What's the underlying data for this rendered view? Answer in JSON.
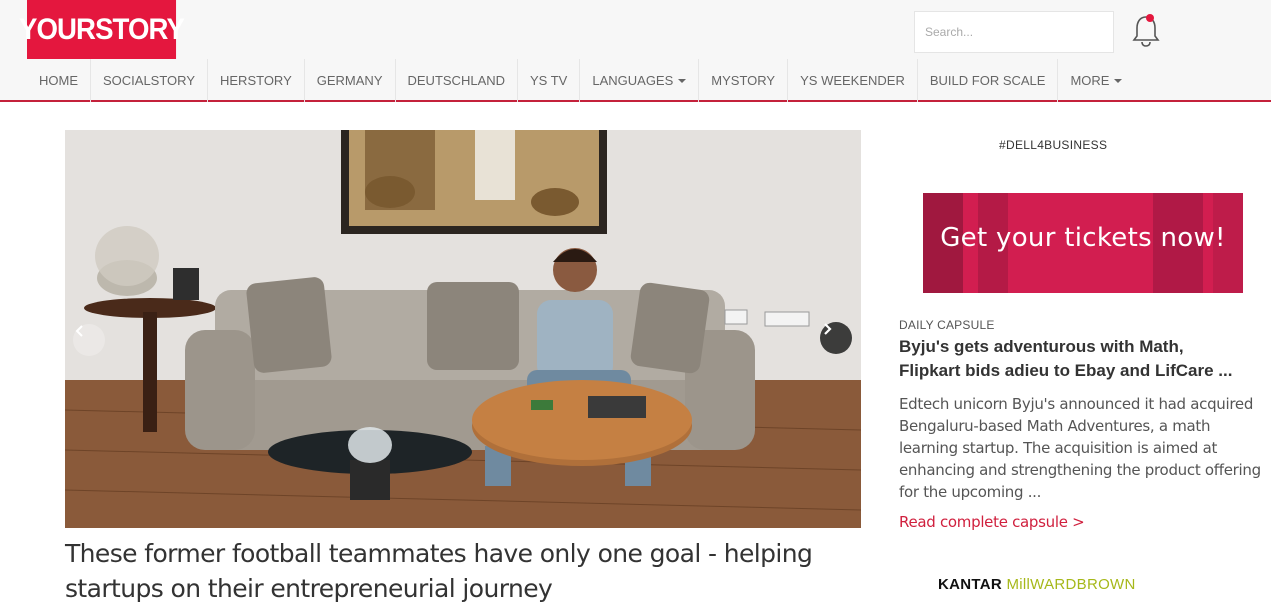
{
  "header": {
    "logo_text": "YOURSTORY",
    "search_placeholder": "Search...",
    "accent_color": "#e4173e"
  },
  "nav": {
    "items": [
      {
        "label": "HOME",
        "dropdown": false
      },
      {
        "label": "SOCIALSTORY",
        "dropdown": false
      },
      {
        "label": "HERSTORY",
        "dropdown": false
      },
      {
        "label": "GERMANY",
        "dropdown": false
      },
      {
        "label": "DEUTSCHLAND",
        "dropdown": false
      },
      {
        "label": "YS TV",
        "dropdown": false
      },
      {
        "label": "LANGUAGES",
        "dropdown": true
      },
      {
        "label": "MYSTORY",
        "dropdown": false
      },
      {
        "label": "YS WEEKENDER",
        "dropdown": false
      },
      {
        "label": "BUILD FOR SCALE",
        "dropdown": false
      },
      {
        "label": "MORE",
        "dropdown": true
      }
    ]
  },
  "hero": {
    "headline": "These former football teammates have only one goal - helping startups on their entrepreneurial journey",
    "prev_icon": "chevron-left-icon",
    "next_icon": "chevron-right-icon"
  },
  "sidebar": {
    "hashtag": "#DELL4BUSINESS",
    "ad_text": "Get your tickets now!",
    "capsule": {
      "label": "DAILY CAPSULE",
      "title": "Byju's gets adventurous with Math,\nFlipkart bids adieu to Ebay and LifCare ...",
      "body": "Edtech unicorn Byju's announced it had acquired Bengaluru-based Math Adventures, a math learning startup. The acquisition is aimed at enhancing and strengthening the product offering for the upcoming ...",
      "link": "Read complete capsule >"
    },
    "sponsor": {
      "part1": "KANTAR ",
      "part2": "MillWARDBROWN"
    }
  }
}
